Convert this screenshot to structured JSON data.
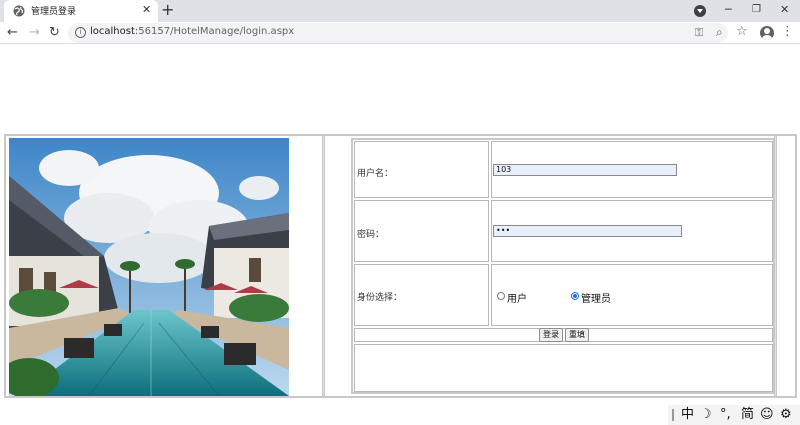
{
  "browser": {
    "tab_title": "管理员登录",
    "tab_close": "✕",
    "new_tab": "+",
    "url_host": "localhost",
    "url_rest": ":56157/HotelManage/login.aspx",
    "controls": {
      "minimize": "─",
      "maximize": "❐",
      "close": "✕"
    },
    "nav": {
      "back": "←",
      "forward": "→",
      "reload": "↻"
    },
    "icons": {
      "key": "⚿",
      "zoom": "⌕",
      "star": "☆",
      "menu": "⋮",
      "info": "i"
    }
  },
  "login": {
    "username_label": "用户名：",
    "username_value": "103",
    "password_label": "密码：",
    "password_value": "•••",
    "role_label": "身份选择：",
    "roles": [
      {
        "label": "用户",
        "checked": false
      },
      {
        "label": "管理员",
        "checked": true
      }
    ],
    "login_button": "登录",
    "reset_button": "重填"
  },
  "ime": {
    "items": [
      "中",
      "☽",
      "°,",
      "简",
      "☺",
      "⚙"
    ]
  },
  "colors": {
    "input_bg": "#e8f0fe",
    "radio_checked": "#1a73e8",
    "tabstrip": "#dee1e6"
  }
}
